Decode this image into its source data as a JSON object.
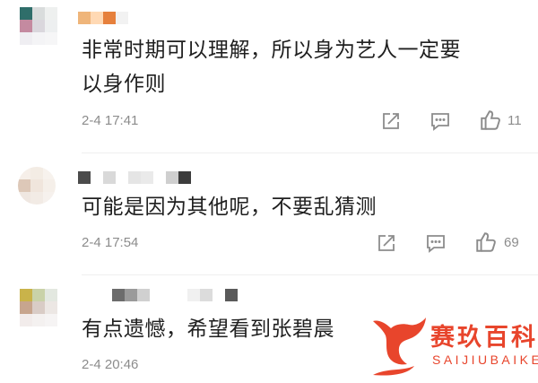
{
  "comments": [
    {
      "text_lines": [
        "非常时期可以理解，所以身为艺人一定要",
        "以身作则"
      ],
      "time": "2-4 17:41",
      "likes": "11"
    },
    {
      "text_lines": [
        "可能是因为其他呢，不要乱猜测"
      ],
      "time": "2-4 17:54",
      "likes": "69"
    },
    {
      "text_lines": [
        "有点遗憾，希望看到张碧晨"
      ],
      "time": "2-4 20:46",
      "likes": ""
    }
  ],
  "icons": {
    "share": "share-icon",
    "reply": "comment-icon",
    "like": "thumbs-up-icon"
  },
  "colors": {
    "text": "#1f1f1f",
    "meta": "#8c8c8c",
    "watermark": "#e8452c"
  },
  "watermark": {
    "cn": "赛玖百科",
    "en": "SAIJIUBAIKE"
  }
}
